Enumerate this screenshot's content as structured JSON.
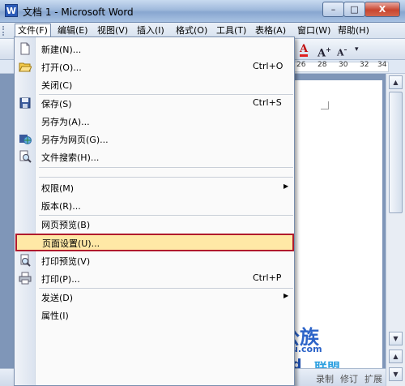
{
  "window": {
    "title": "文档 1 - Microsoft Word",
    "app_icon": "W",
    "buttons": {
      "minimize": "–",
      "maximize": "□",
      "close": "X"
    }
  },
  "menubar": [
    {
      "label": "文件(F)",
      "active": true
    },
    {
      "label": "编辑(E)"
    },
    {
      "label": "视图(V)"
    },
    {
      "label": "插入(I)"
    },
    {
      "label": "格式(O)"
    },
    {
      "label": "工具(T)"
    },
    {
      "label": "表格(A)"
    },
    {
      "label": "窗口(W)"
    },
    {
      "label": "帮助(H)"
    }
  ],
  "toolbar": {
    "font_color_glyph": "A",
    "grow_font_glyph": "A",
    "shrink_font_glyph": "A"
  },
  "ruler": {
    "numbers": [
      "26",
      "28",
      "30",
      "32",
      "34"
    ]
  },
  "file_menu": {
    "items": [
      {
        "label": "新建(N)...",
        "icon": "new-document-icon"
      },
      {
        "label": "打开(O)...",
        "shortcut": "Ctrl+O",
        "icon": "open-folder-icon"
      },
      {
        "label": "关闭(C)"
      },
      {
        "label": "保存(S)",
        "shortcut": "Ctrl+S",
        "icon": "save-disk-icon"
      },
      {
        "label": "另存为(A)..."
      },
      {
        "label": "另存为网页(G)...",
        "icon": "save-web-page-icon"
      },
      {
        "label": "文件搜索(H)...",
        "icon": "file-search-icon"
      },
      {
        "label": "权限(M)",
        "submenu": true
      },
      {
        "label": "版本(R)..."
      },
      {
        "label": "网页预览(B)"
      },
      {
        "label": "页面设置(U)...",
        "highlighted": true
      },
      {
        "label": "打印预览(V)",
        "icon": "print-preview-icon"
      },
      {
        "label": "打印(P)...",
        "shortcut": "Ctrl+P",
        "icon": "printer-icon"
      },
      {
        "label": "发送(D)",
        "submenu": true
      },
      {
        "label": "属性(I)"
      }
    ],
    "highlight_color": "#b01a2c"
  },
  "statusbar": {
    "items": [
      "录制",
      "修订",
      "扩展"
    ]
  },
  "watermark": {
    "cn": "办公族",
    "url": "Officezu.com",
    "word": "Word",
    "cn2": "联盟"
  }
}
